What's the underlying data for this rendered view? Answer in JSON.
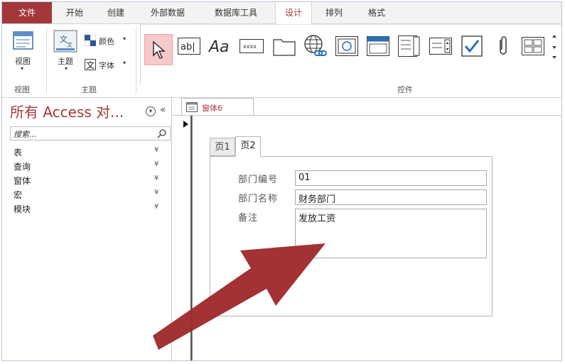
{
  "ribbon_tabs": [
    {
      "label": "文件"
    },
    {
      "label": "开始"
    },
    {
      "label": "创建"
    },
    {
      "label": "外部数据"
    },
    {
      "label": "数据库工具"
    },
    {
      "label": "设计"
    },
    {
      "label": "排列"
    },
    {
      "label": "格式"
    }
  ],
  "ribbon": {
    "view_label": "视图",
    "theme_label": "主题",
    "colors_label": "颜色",
    "fonts_label": "字体",
    "groups": {
      "view": "视图",
      "theme": "主题",
      "controls": "控件"
    },
    "controls": [
      {
        "name": "select-tool"
      },
      {
        "name": "textbox-control",
        "text": "ab|"
      },
      {
        "name": "label-control",
        "text": "Aa"
      },
      {
        "name": "button-control",
        "text": "xxxx"
      },
      {
        "name": "tab-control"
      },
      {
        "name": "hyperlink-control"
      },
      {
        "name": "web-browser-control"
      },
      {
        "name": "navigation-control"
      },
      {
        "name": "option-group-control"
      },
      {
        "name": "combo-control"
      },
      {
        "name": "checkbox-control"
      },
      {
        "name": "attachment-control"
      },
      {
        "name": "more-control"
      }
    ]
  },
  "nav": {
    "title": "所有 Access 对...",
    "search_placeholder": "搜索...",
    "items": [
      {
        "label": "表"
      },
      {
        "label": "查询"
      },
      {
        "label": "窗体"
      },
      {
        "label": "宏"
      },
      {
        "label": "模块"
      }
    ]
  },
  "document": {
    "tab_label": "窗体6",
    "page_tabs": [
      {
        "label": "页1"
      },
      {
        "label": "页2"
      }
    ],
    "fields": [
      {
        "label": "部门编号",
        "value": "01"
      },
      {
        "label": "部门名称",
        "value": "财务部门"
      },
      {
        "label": "备注",
        "value": "发放工资"
      }
    ]
  },
  "colors": {
    "accent": "#a4373a",
    "arrow": "#9e2a2b"
  }
}
